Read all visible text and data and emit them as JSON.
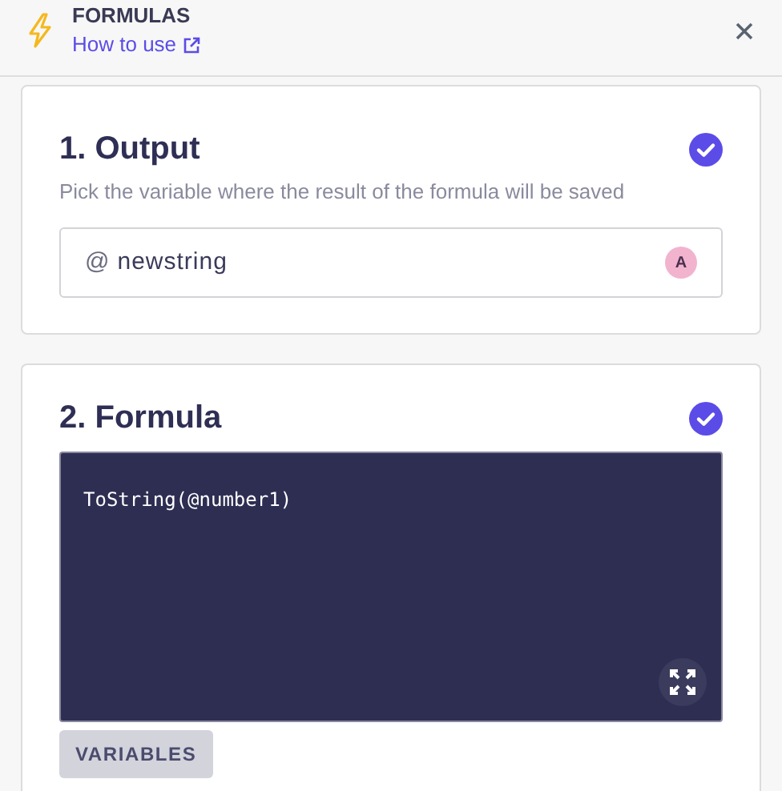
{
  "header": {
    "title": "FORMULAS",
    "link": "How to use"
  },
  "sections": [
    {
      "kind": "output",
      "title": "1. Output",
      "complete": true,
      "description": "Pick the variable where the result of the formula will be saved",
      "field": {
        "prefix": "@",
        "value": "newstring",
        "badge": "A"
      }
    },
    {
      "kind": "formula",
      "title": "2. Formula",
      "complete": true,
      "code": "ToString(@number1)",
      "button": "VARIABLES"
    }
  ]
}
